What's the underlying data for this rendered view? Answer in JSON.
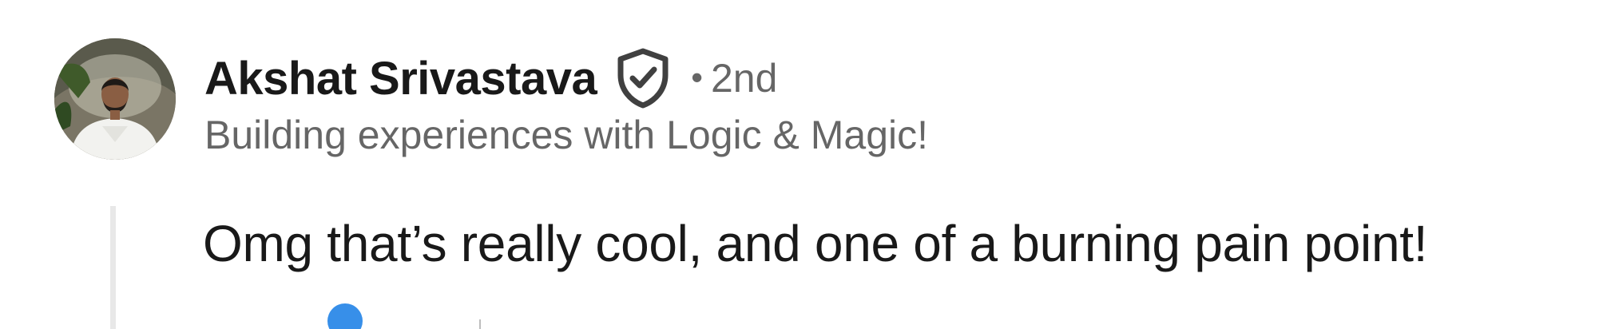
{
  "comment": {
    "author": {
      "name": "Akshat Srivastava",
      "degree": "2nd",
      "degree_separator": "•",
      "headline": "Building experiences with Logic & Magic!",
      "verified_icon": "verified-shield-icon"
    },
    "text": "Omg that’s really cool, and one of a burning pain point!",
    "reaction_icon": "like-reaction-icon"
  },
  "colors": {
    "primary_text": "#191919",
    "secondary_text": "#666666",
    "thread_line": "#e8e8e8",
    "reaction_blue": "#378fe9"
  }
}
